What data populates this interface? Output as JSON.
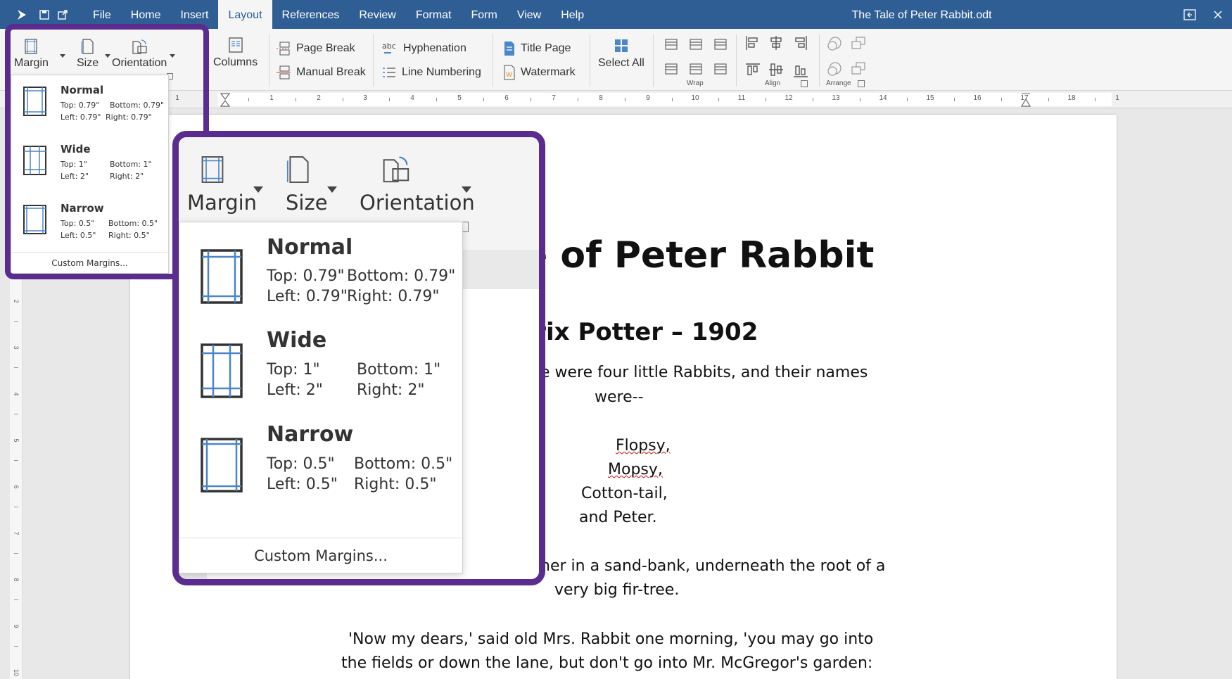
{
  "window": {
    "title": "The Tale of Peter Rabbit.odt"
  },
  "menu": {
    "items": [
      "File",
      "Home",
      "Insert",
      "Layout",
      "References",
      "Review",
      "Format",
      "Form",
      "View",
      "Help"
    ],
    "active": "Layout"
  },
  "ribbon": {
    "margin": "Margin",
    "size": "Size",
    "orientation": "Orientation",
    "columns": "Columns",
    "page_break": "Page Break",
    "manual_break": "Manual Break",
    "hyphenation": "Hyphenation",
    "line_numbering": "Line Numbering",
    "title_page": "Title Page",
    "watermark": "Watermark",
    "select_all": "Select All",
    "wrap": "Wrap",
    "align": "Align",
    "arrange": "Arrange"
  },
  "ruler": {
    "numbers": [
      "1",
      "1",
      "2",
      "3",
      "4",
      "5",
      "6",
      "7",
      "8",
      "9",
      "10",
      "11",
      "12",
      "13",
      "14",
      "15",
      "16",
      "17",
      "18",
      "1"
    ]
  },
  "vruler": {
    "numbers": [
      "2",
      "3",
      "4",
      "5",
      "6",
      "7",
      "8",
      "9",
      "10"
    ]
  },
  "margin_menu": {
    "presets": [
      {
        "name": "Normal",
        "top": "Top: 0.79\"",
        "bottom": "Bottom: 0.79\"",
        "left": "Left: 0.79\"",
        "right": "Right: 0.79\""
      },
      {
        "name": "Wide",
        "top": "Top: 1\"",
        "bottom": "Bottom: 1\"",
        "left": "Left: 2\"",
        "right": "Right: 2\""
      },
      {
        "name": "Narrow",
        "top": "Top: 0.5\"",
        "bottom": "Bottom: 0.5\"",
        "left": "Left: 0.5\"",
        "right": "Right: 0.5\""
      }
    ],
    "custom": "Custom Margins..."
  },
  "zoom_ruler_number": "1",
  "document": {
    "title_visible": "e of Peter Rabbit",
    "subtitle_visible": "trix Potter – 1902",
    "p1_line1": "e were four little Rabbits, and their names",
    "p1_line2": "were--",
    "names": [
      "Flopsy,",
      "Mopsy,",
      "Cotton-tail,",
      "and Peter."
    ],
    "p2_line1": "her in a sand-bank, underneath the root of a",
    "p2_line2": "very big fir-tree.",
    "p3_line1": "'Now my dears,' said old Mrs. Rabbit one morning, 'you may go into",
    "p3_line2": "the fields or down the lane, but don't go into Mr. McGregor's garden:"
  },
  "colors": {
    "titlebar": "#2f5e95",
    "highlight": "#5b2c8f",
    "icon_blue": "#4a86c8"
  }
}
